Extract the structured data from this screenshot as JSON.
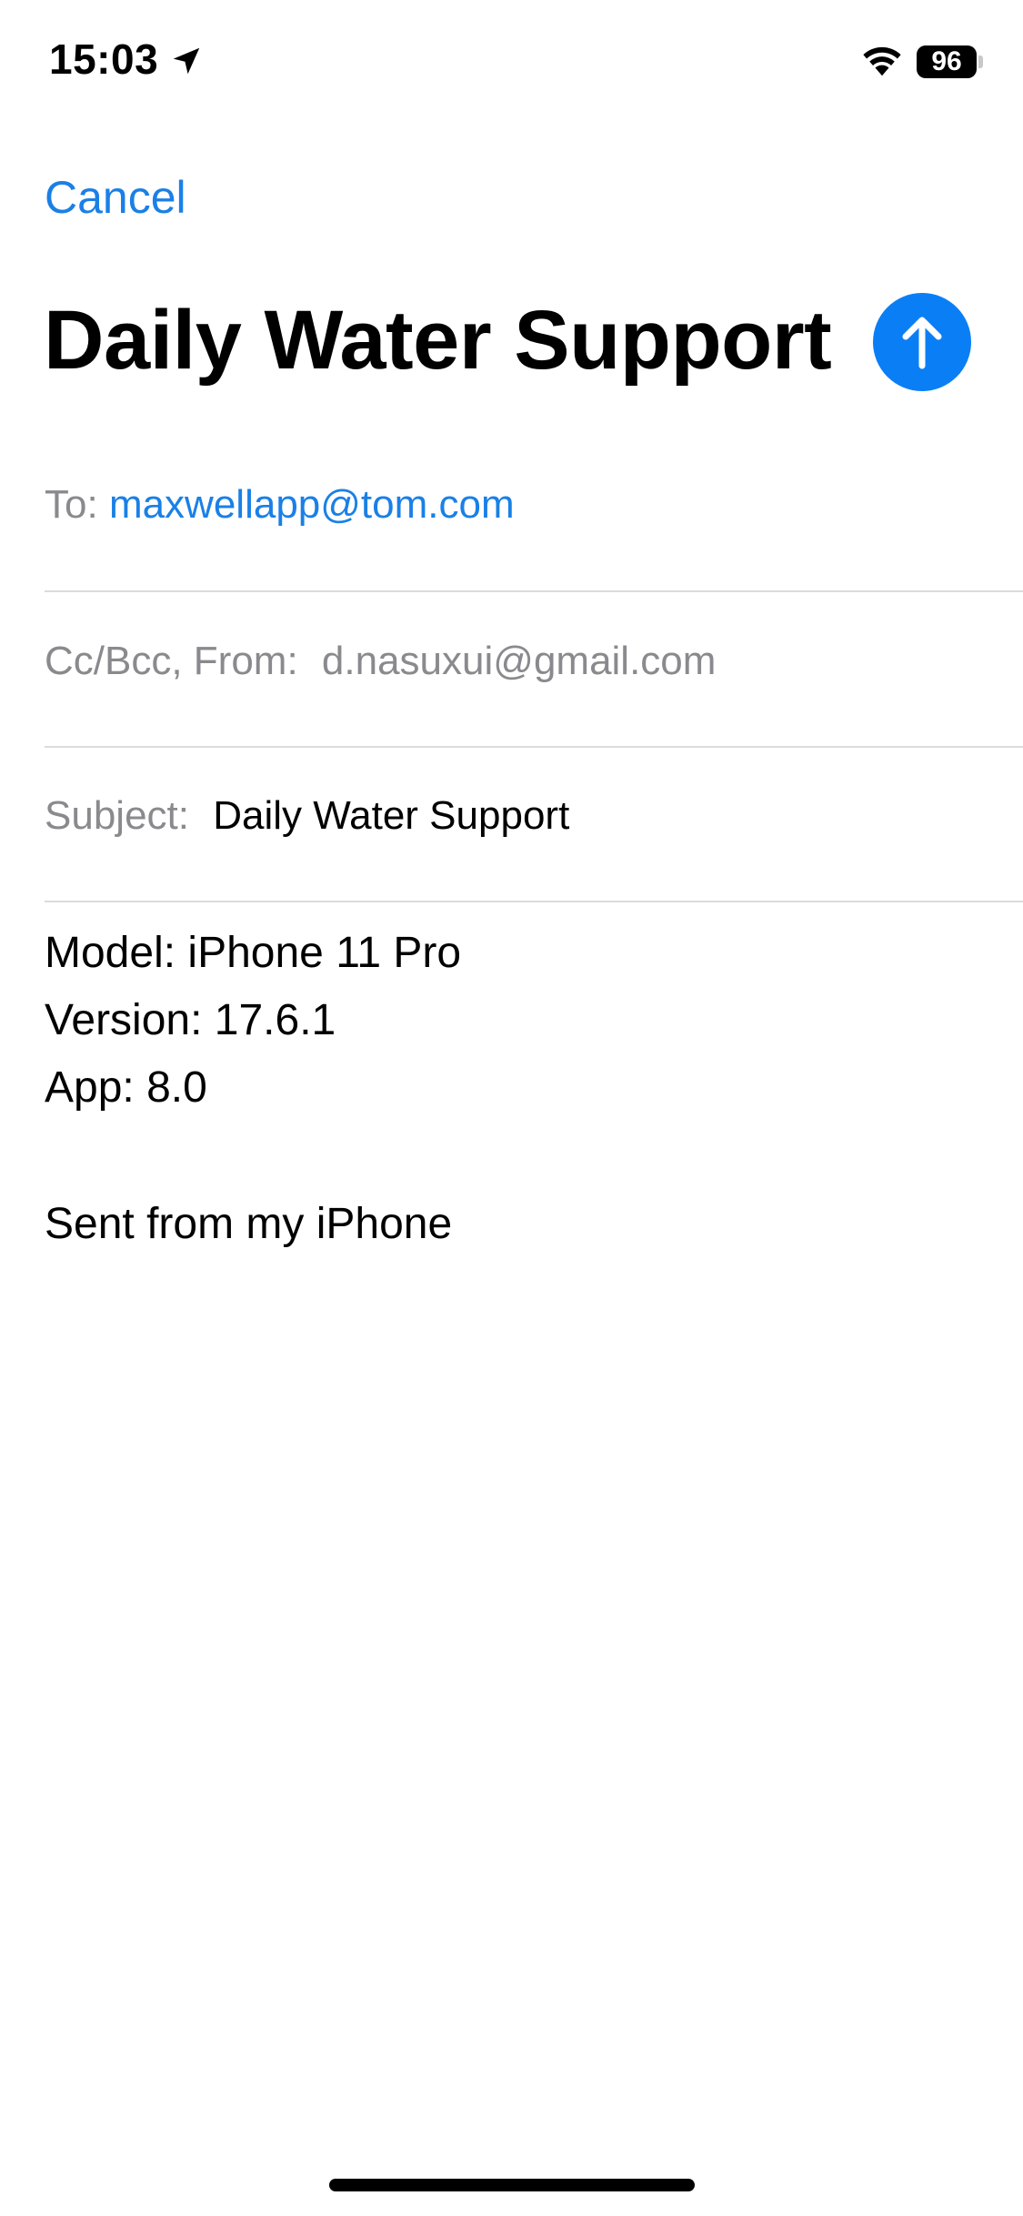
{
  "status_bar": {
    "time": "15:03",
    "battery_level": "96",
    "icons": [
      "location-arrow-icon",
      "wifi-icon",
      "battery-icon"
    ]
  },
  "nav": {
    "cancel_label": "Cancel"
  },
  "compose": {
    "title": "Daily Water Support",
    "send_icon": "arrow-up-icon",
    "accent_color": "#0a7ff5"
  },
  "fields": {
    "to_label": "To:",
    "to_value": "maxwellapp@tom.com",
    "cc_label": "Cc/Bcc, From:",
    "cc_value": "d.nasuxui@gmail.com",
    "subject_label": "Subject:",
    "subject_value": "Daily Water Support"
  },
  "body": {
    "lines": [
      "Model: iPhone 11 Pro",
      "Version: 17.6.1",
      "App: 8.0"
    ],
    "signature": "Sent from my iPhone"
  }
}
